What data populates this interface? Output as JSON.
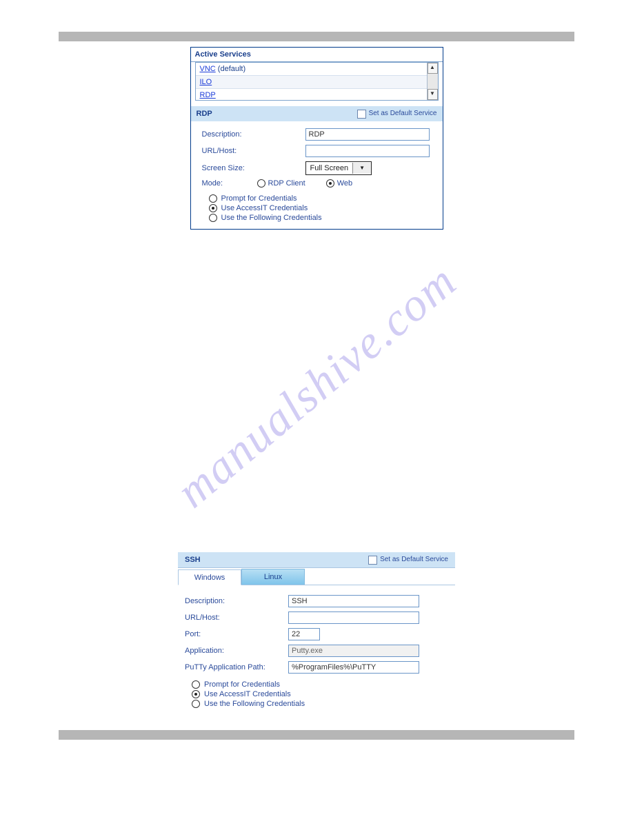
{
  "watermark": "manualshive.com",
  "panel1": {
    "heading": "Active Services",
    "list": {
      "item0_link": "VNC",
      "item0_suffix": " (default)",
      "item1": "ILO",
      "item2": "RDP"
    },
    "section_title": "RDP",
    "set_default_label": "Set as Default Service",
    "desc_label": "Description:",
    "desc_value": "RDP",
    "url_label": "URL/Host:",
    "url_value": "",
    "size_label": "Screen Size:",
    "size_value": "Full Screen",
    "mode_label": "Mode:",
    "mode_opt1": "RDP Client",
    "mode_opt2": "Web",
    "cred_opt1": "Prompt for Credentials",
    "cred_opt2": "Use AccessIT Credentials",
    "cred_opt3": "Use the Following Credentials"
  },
  "panel2": {
    "section_title": "SSH",
    "set_default_label": "Set as Default Service",
    "tab1": "Windows",
    "tab2": "Linux",
    "desc_label": "Description:",
    "desc_value": "SSH",
    "url_label": "URL/Host:",
    "url_value": "",
    "port_label": "Port:",
    "port_value": "22",
    "app_label": "Application:",
    "app_value": "Putty.exe",
    "path_label": "PuTTy Application Path:",
    "path_value": "%ProgramFiles%\\PuTTY",
    "cred_opt1": "Prompt for Credentials",
    "cred_opt2": "Use AccessIT Credentials",
    "cred_opt3": "Use the Following Credentials"
  }
}
